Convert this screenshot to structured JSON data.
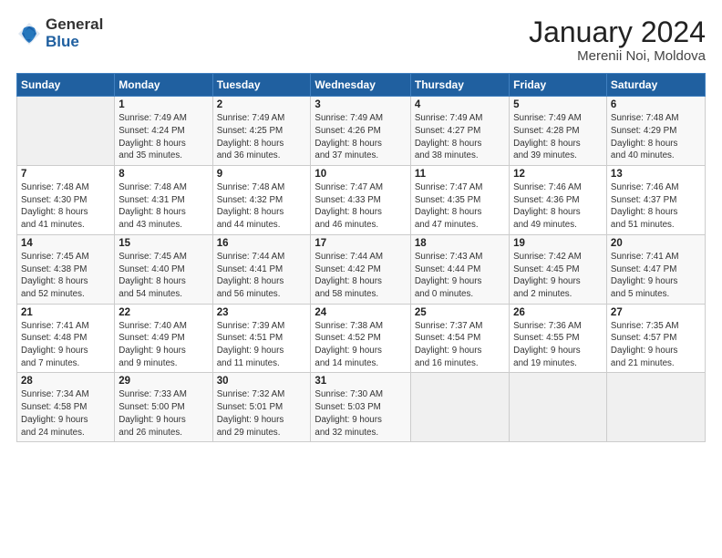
{
  "logo": {
    "general": "General",
    "blue": "Blue"
  },
  "header": {
    "title": "January 2024",
    "subtitle": "Merenii Noi, Moldova"
  },
  "days_of_week": [
    "Sunday",
    "Monday",
    "Tuesday",
    "Wednesday",
    "Thursday",
    "Friday",
    "Saturday"
  ],
  "weeks": [
    [
      {
        "day": "",
        "info": ""
      },
      {
        "day": "1",
        "info": "Sunrise: 7:49 AM\nSunset: 4:24 PM\nDaylight: 8 hours\nand 35 minutes."
      },
      {
        "day": "2",
        "info": "Sunrise: 7:49 AM\nSunset: 4:25 PM\nDaylight: 8 hours\nand 36 minutes."
      },
      {
        "day": "3",
        "info": "Sunrise: 7:49 AM\nSunset: 4:26 PM\nDaylight: 8 hours\nand 37 minutes."
      },
      {
        "day": "4",
        "info": "Sunrise: 7:49 AM\nSunset: 4:27 PM\nDaylight: 8 hours\nand 38 minutes."
      },
      {
        "day": "5",
        "info": "Sunrise: 7:49 AM\nSunset: 4:28 PM\nDaylight: 8 hours\nand 39 minutes."
      },
      {
        "day": "6",
        "info": "Sunrise: 7:48 AM\nSunset: 4:29 PM\nDaylight: 8 hours\nand 40 minutes."
      }
    ],
    [
      {
        "day": "7",
        "info": "Sunrise: 7:48 AM\nSunset: 4:30 PM\nDaylight: 8 hours\nand 41 minutes."
      },
      {
        "day": "8",
        "info": "Sunrise: 7:48 AM\nSunset: 4:31 PM\nDaylight: 8 hours\nand 43 minutes."
      },
      {
        "day": "9",
        "info": "Sunrise: 7:48 AM\nSunset: 4:32 PM\nDaylight: 8 hours\nand 44 minutes."
      },
      {
        "day": "10",
        "info": "Sunrise: 7:47 AM\nSunset: 4:33 PM\nDaylight: 8 hours\nand 46 minutes."
      },
      {
        "day": "11",
        "info": "Sunrise: 7:47 AM\nSunset: 4:35 PM\nDaylight: 8 hours\nand 47 minutes."
      },
      {
        "day": "12",
        "info": "Sunrise: 7:46 AM\nSunset: 4:36 PM\nDaylight: 8 hours\nand 49 minutes."
      },
      {
        "day": "13",
        "info": "Sunrise: 7:46 AM\nSunset: 4:37 PM\nDaylight: 8 hours\nand 51 minutes."
      }
    ],
    [
      {
        "day": "14",
        "info": "Sunrise: 7:45 AM\nSunset: 4:38 PM\nDaylight: 8 hours\nand 52 minutes."
      },
      {
        "day": "15",
        "info": "Sunrise: 7:45 AM\nSunset: 4:40 PM\nDaylight: 8 hours\nand 54 minutes."
      },
      {
        "day": "16",
        "info": "Sunrise: 7:44 AM\nSunset: 4:41 PM\nDaylight: 8 hours\nand 56 minutes."
      },
      {
        "day": "17",
        "info": "Sunrise: 7:44 AM\nSunset: 4:42 PM\nDaylight: 8 hours\nand 58 minutes."
      },
      {
        "day": "18",
        "info": "Sunrise: 7:43 AM\nSunset: 4:44 PM\nDaylight: 9 hours\nand 0 minutes."
      },
      {
        "day": "19",
        "info": "Sunrise: 7:42 AM\nSunset: 4:45 PM\nDaylight: 9 hours\nand 2 minutes."
      },
      {
        "day": "20",
        "info": "Sunrise: 7:41 AM\nSunset: 4:47 PM\nDaylight: 9 hours\nand 5 minutes."
      }
    ],
    [
      {
        "day": "21",
        "info": "Sunrise: 7:41 AM\nSunset: 4:48 PM\nDaylight: 9 hours\nand 7 minutes."
      },
      {
        "day": "22",
        "info": "Sunrise: 7:40 AM\nSunset: 4:49 PM\nDaylight: 9 hours\nand 9 minutes."
      },
      {
        "day": "23",
        "info": "Sunrise: 7:39 AM\nSunset: 4:51 PM\nDaylight: 9 hours\nand 11 minutes."
      },
      {
        "day": "24",
        "info": "Sunrise: 7:38 AM\nSunset: 4:52 PM\nDaylight: 9 hours\nand 14 minutes."
      },
      {
        "day": "25",
        "info": "Sunrise: 7:37 AM\nSunset: 4:54 PM\nDaylight: 9 hours\nand 16 minutes."
      },
      {
        "day": "26",
        "info": "Sunrise: 7:36 AM\nSunset: 4:55 PM\nDaylight: 9 hours\nand 19 minutes."
      },
      {
        "day": "27",
        "info": "Sunrise: 7:35 AM\nSunset: 4:57 PM\nDaylight: 9 hours\nand 21 minutes."
      }
    ],
    [
      {
        "day": "28",
        "info": "Sunrise: 7:34 AM\nSunset: 4:58 PM\nDaylight: 9 hours\nand 24 minutes."
      },
      {
        "day": "29",
        "info": "Sunrise: 7:33 AM\nSunset: 5:00 PM\nDaylight: 9 hours\nand 26 minutes."
      },
      {
        "day": "30",
        "info": "Sunrise: 7:32 AM\nSunset: 5:01 PM\nDaylight: 9 hours\nand 29 minutes."
      },
      {
        "day": "31",
        "info": "Sunrise: 7:30 AM\nSunset: 5:03 PM\nDaylight: 9 hours\nand 32 minutes."
      },
      {
        "day": "",
        "info": ""
      },
      {
        "day": "",
        "info": ""
      },
      {
        "day": "",
        "info": ""
      }
    ]
  ]
}
